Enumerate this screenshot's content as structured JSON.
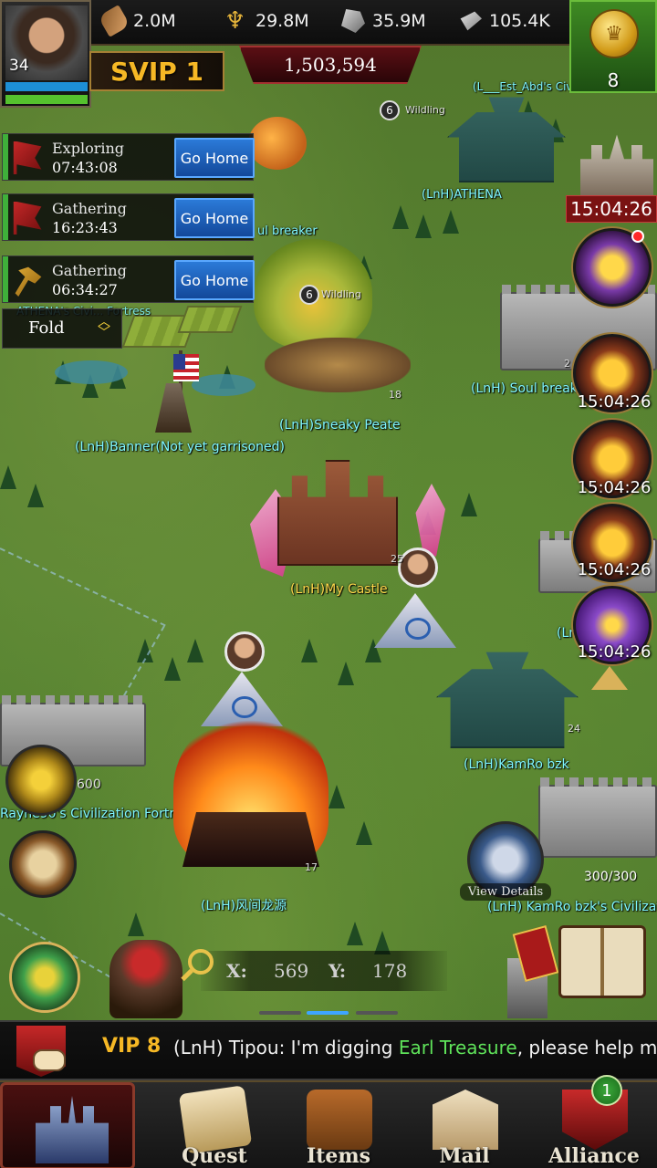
{
  "resources": {
    "wood": "2.0M",
    "food": "29.8M",
    "stone": "35.9M",
    "iron": "105.4K"
  },
  "player": {
    "level": "34",
    "svip": "SVIP 1",
    "power": "1,503,594"
  },
  "gold": {
    "count": "8"
  },
  "marches": [
    {
      "status": "Exploring",
      "time": "07:43:08",
      "button": "Go Home",
      "icon": "flag-icon"
    },
    {
      "status": "Gathering",
      "time": "16:23:43",
      "button": "Go Home",
      "icon": "flag-icon"
    },
    {
      "status": "Gathering",
      "time": "06:34:27",
      "button": "Go Home",
      "icon": "pickaxe-icon"
    }
  ],
  "fold_label": "Fold",
  "map_labels": {
    "civic": "(L___Est_Abd's Civi",
    "athena": "(LnH)ATHENA",
    "wildling_top": "Wildling",
    "wildling_top_level": "6",
    "soul_breaker_top": "ul breaker",
    "wildling_mid_level": "6",
    "wildling_mid": "Wildling",
    "fortress_left": "ATHENA's Civi... Fortress",
    "sneaky_peate": "(LnH)Sneaky Peate",
    "soul_breaker_right": "(LnH) Soul breaker",
    "banner": "(LnH)Banner(Not yet garrisoned)",
    "my_castle": "(LnH)My Castle",
    "ln_right": "(Ln",
    "kamro": "(LnH)KamRo bzk",
    "civ_fortress_left": "Rayne90's Civilization Fortress",
    "dragon": "(LnH)风间龙源",
    "kamro_civ": "(LnH) KamRo bzk's Civilizat",
    "count_600": "600",
    "level_25": "25",
    "level_18": "18",
    "level_17": "17",
    "level_24": "24",
    "count_2": "2"
  },
  "event_timers": {
    "palace": "15:04:26",
    "chest1": "15:04:26",
    "chest2": "15:04:26",
    "chest3": "15:04:26",
    "gift": "15:04:26"
  },
  "coords": {
    "x_label": "X:",
    "x": "569",
    "y_label": "Y:",
    "y": "178"
  },
  "view_details": "View Details",
  "capacity": "300/300",
  "chat": {
    "vip": "VIP 8",
    "prefix": "(LnH) Tipou: I'm digging ",
    "highlight": "Earl Treasure",
    "suffix": ", please help me"
  },
  "nav": {
    "quest": "Quest",
    "items": "Items",
    "mail": "Mail",
    "alliance": "Alliance",
    "alliance_badge": "1"
  },
  "colors": {
    "go_home_blue": "#1f62c0",
    "svip_gold": "#f6b825",
    "map_label_cyan": "#7ff6ff",
    "chat_highlight": "#5fe35a",
    "timer_red": "#7a1212"
  }
}
